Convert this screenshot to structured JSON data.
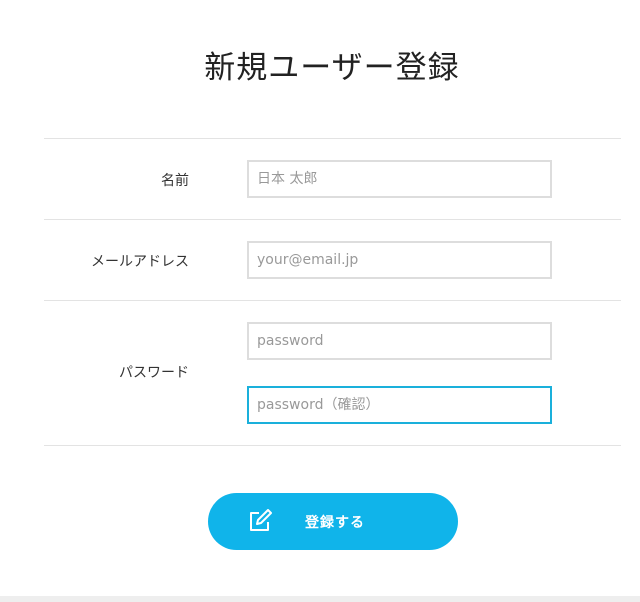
{
  "page": {
    "title": "新規ユーザー登録"
  },
  "form": {
    "name": {
      "label": "名前",
      "placeholder": "日本 太郎"
    },
    "email": {
      "label": "メールアドレス",
      "placeholder": "your@email.jp"
    },
    "password": {
      "label": "パスワード",
      "placeholder": "password",
      "confirm_placeholder": "password（確認）"
    },
    "submit_label": "登録する",
    "submit_icon": "edit-icon"
  },
  "colors": {
    "accent": "#10b4ea",
    "focus_border": "#1ab0db",
    "input_border": "#dddddd",
    "row_divider": "#e3e3e3"
  }
}
